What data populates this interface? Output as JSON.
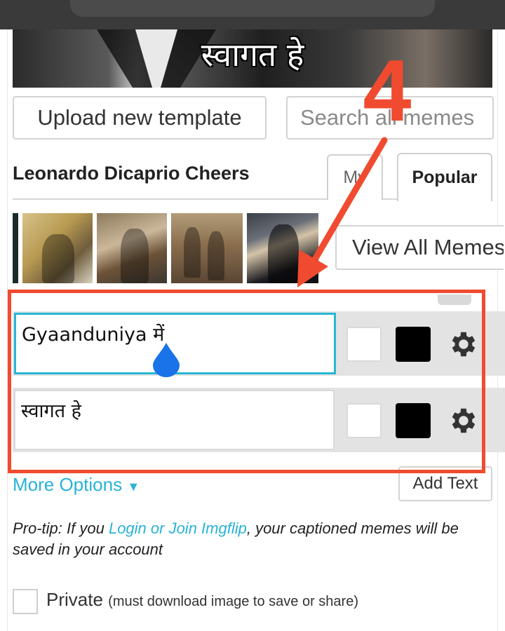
{
  "preview": {
    "caption": "स्वागत हे"
  },
  "toolbar": {
    "upload_label": "Upload new template",
    "search_placeholder": "Search all memes"
  },
  "template": {
    "title": "Leonardo Dicaprio Cheers"
  },
  "tabs": [
    {
      "label": "My"
    },
    {
      "label": "Popular"
    }
  ],
  "thumbnails": [
    "meme-thumbnail",
    "meme-thumbnail",
    "meme-thumbnail",
    "meme-thumbnail"
  ],
  "view_all_label": "View All Memes",
  "text_boxes": [
    {
      "value": "Gyaanduniya में",
      "color_outline": "#ffffff",
      "color_fill": "#000000"
    },
    {
      "value": "स्वागत हे",
      "color_outline": "#ffffff",
      "color_fill": "#000000"
    }
  ],
  "more_options_label": "More Options",
  "add_text_label": "Add Text",
  "protip": {
    "prefix": "Pro-tip: If you ",
    "link": "Login or Join Imgflip",
    "suffix": ", your captioned memes will be saved in your account"
  },
  "private": {
    "label": "Private",
    "note": "(must download image to save or share)"
  },
  "annotation": {
    "step_number": "4",
    "color": "#f04b30"
  },
  "colors": {
    "accent": "#29b2d6",
    "annotation": "#f04b30"
  }
}
